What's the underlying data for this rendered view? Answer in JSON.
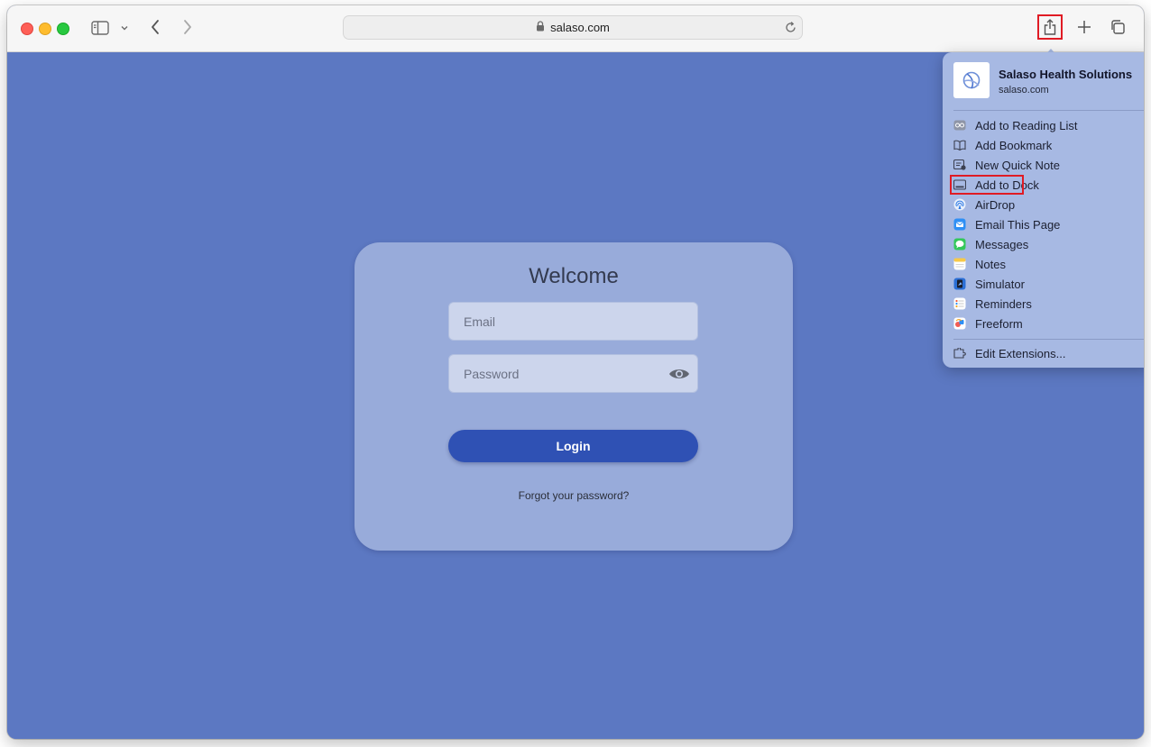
{
  "browser": {
    "url": "salaso.com",
    "url_lock_icon": "lock-icon",
    "toolbar_icons": [
      "sidebar-icon",
      "chevron-down-icon",
      "back-icon",
      "forward-icon",
      "reload-icon",
      "share-icon",
      "new-tab-icon",
      "tab-overview-icon"
    ]
  },
  "login": {
    "title": "Welcome",
    "email_placeholder": "Email",
    "password_placeholder": "Password",
    "login_label": "Login",
    "forgot_label": "Forgot your password?"
  },
  "share_menu": {
    "site_name": "Salaso Health Solutions",
    "site_domain": "salaso.com",
    "items": [
      {
        "label": "Add to Reading List",
        "icon": "reading-list-icon"
      },
      {
        "label": "Add Bookmark",
        "icon": "bookmark-icon"
      },
      {
        "label": "New Quick Note",
        "icon": "quick-note-icon"
      },
      {
        "label": "Add to Dock",
        "icon": "dock-icon"
      },
      {
        "label": "AirDrop",
        "icon": "airdrop-icon"
      },
      {
        "label": "Email This Page",
        "icon": "mail-icon"
      },
      {
        "label": "Messages",
        "icon": "messages-icon"
      },
      {
        "label": "Notes",
        "icon": "notes-icon"
      },
      {
        "label": "Simulator",
        "icon": "simulator-icon"
      },
      {
        "label": "Reminders",
        "icon": "reminders-icon"
      },
      {
        "label": "Freeform",
        "icon": "freeform-icon"
      }
    ],
    "edit_extensions_label": "Edit Extensions..."
  },
  "colors": {
    "page_background": "#5c78c2",
    "card_background": "#98abda",
    "login_button": "#2f51b4",
    "highlight": "#e01b24"
  }
}
